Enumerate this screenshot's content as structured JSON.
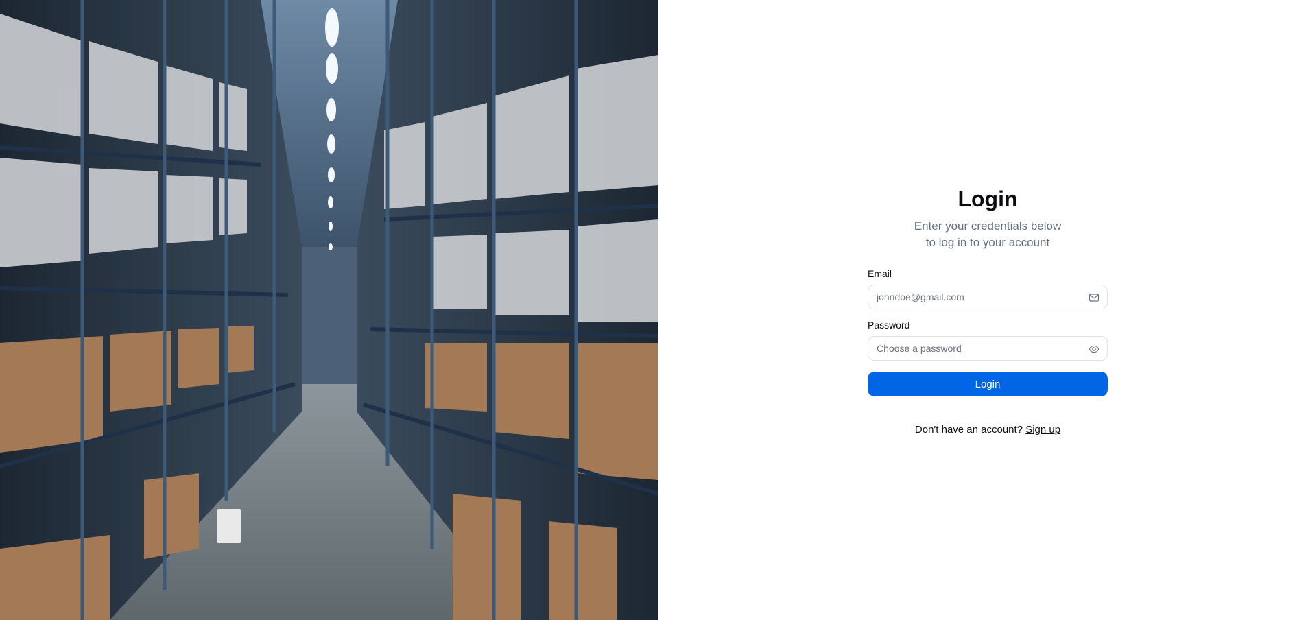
{
  "hero": {
    "image_icon": "warehouse-aisle-photo"
  },
  "login": {
    "title": "Login",
    "subtitle_line1": "Enter your credentials below",
    "subtitle_line2": "to log in to your account",
    "email": {
      "label": "Email",
      "placeholder": "johndoe@gmail.com",
      "value": "",
      "icon": "mail-icon"
    },
    "password": {
      "label": "Password",
      "placeholder": "Choose a password",
      "value": "",
      "icon": "eye-icon"
    },
    "submit_label": "Login",
    "signup_prompt": "Don't have an account?",
    "signup_link": "Sign up"
  },
  "colors": {
    "primary": "#0066e5",
    "muted_text": "#667085",
    "border": "#dfe3e8"
  }
}
